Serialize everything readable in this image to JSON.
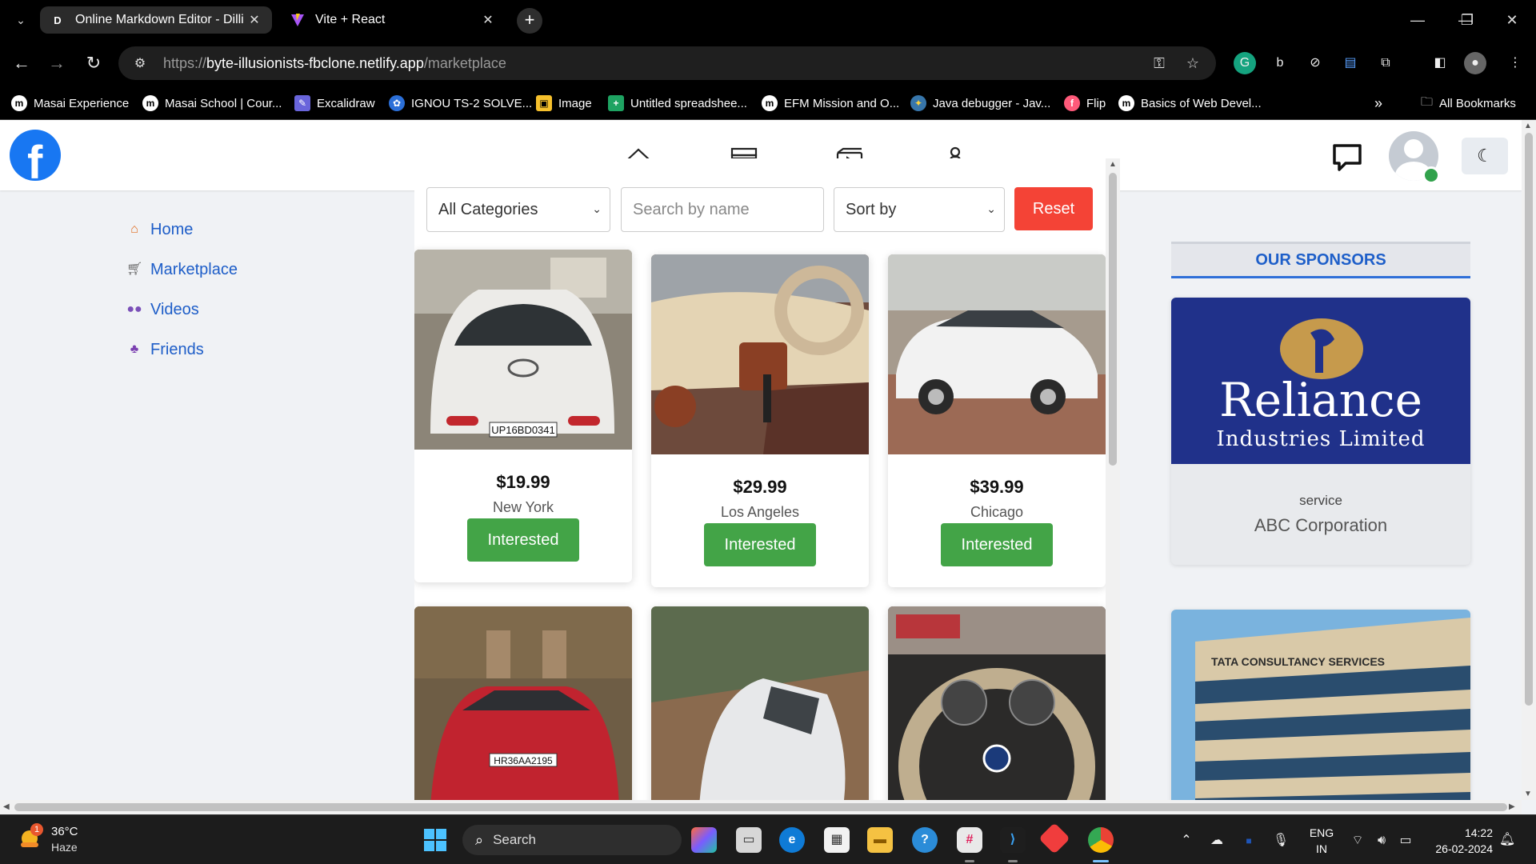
{
  "browser": {
    "tabs": [
      {
        "title": "Online Markdown Editor - Dilli",
        "favicon": "D",
        "active": true
      },
      {
        "title": "Vite + React",
        "favicon": "vite-logo",
        "active": false
      }
    ],
    "url_prefix": "https://",
    "url_domain": "byte-illusionists-fbclone.netlify.app",
    "url_path": "/marketplace",
    "bookmarks": [
      {
        "label": "Masai Experience",
        "icon": "m"
      },
      {
        "label": "Masai School | Cour...",
        "icon": "m"
      },
      {
        "label": "Excalidraw",
        "icon": "excalidraw-icon"
      },
      {
        "label": "IGNOU TS-2 SOLVE...",
        "icon": "ignou-icon"
      },
      {
        "label": "Image",
        "icon": "image-icon"
      },
      {
        "label": "Untitled spreadshee...",
        "icon": "sheets-icon"
      },
      {
        "label": "EFM Mission and O...",
        "icon": "m"
      },
      {
        "label": "Java debugger - Jav...",
        "icon": "python-icon"
      },
      {
        "label": "Flip",
        "icon": "flip-icon"
      },
      {
        "label": "Basics of Web Devel...",
        "icon": "m"
      }
    ],
    "all_bookmarks_label": "All Bookmarks"
  },
  "left_nav": {
    "items": [
      {
        "label": "Home",
        "icon": "home-icon"
      },
      {
        "label": "Marketplace",
        "icon": "cart-icon"
      },
      {
        "label": "Videos",
        "icon": "people-icon"
      },
      {
        "label": "Friends",
        "icon": "friends-icon"
      }
    ]
  },
  "filters": {
    "category": "All Categories",
    "search_placeholder": "Search by name",
    "sort": "Sort by",
    "reset_label": "Reset"
  },
  "products": [
    {
      "price": "$19.99",
      "location": "New York",
      "button": "Interested",
      "photo": "white hatchback rear view"
    },
    {
      "price": "$29.99",
      "location": "Los Angeles",
      "button": "Interested",
      "photo": "car interior dashboard"
    },
    {
      "price": "$39.99",
      "location": "Chicago",
      "button": "Interested",
      "photo": "white sedan side view"
    },
    {
      "price": "",
      "location": "",
      "button": "",
      "photo": "red hatchback front view"
    },
    {
      "price": "",
      "location": "",
      "button": "",
      "photo": "white car on dirt road"
    },
    {
      "price": "",
      "location": "",
      "button": "",
      "photo": "steering wheel close-up"
    }
  ],
  "sponsors": {
    "title": "OUR SPONSORS",
    "items": [
      {
        "logo_line1": "Reliance",
        "logo_line2": "Industries Limited",
        "type": "service",
        "name": "ABC Corporation"
      },
      {
        "logo_text": "TATA CONSULTANCY SERVICES"
      }
    ]
  },
  "taskbar": {
    "temperature": "36°C",
    "weather": "Haze",
    "weather_badge": "1",
    "search_label": "Search",
    "lang_line1": "ENG",
    "lang_line2": "IN",
    "time": "14:22",
    "date": "26-02-2024"
  },
  "colors": {
    "facebook_blue": "#1877f2",
    "reset_red": "#f44336",
    "interested_green": "#43a447",
    "link_blue": "#1d5dc8"
  }
}
